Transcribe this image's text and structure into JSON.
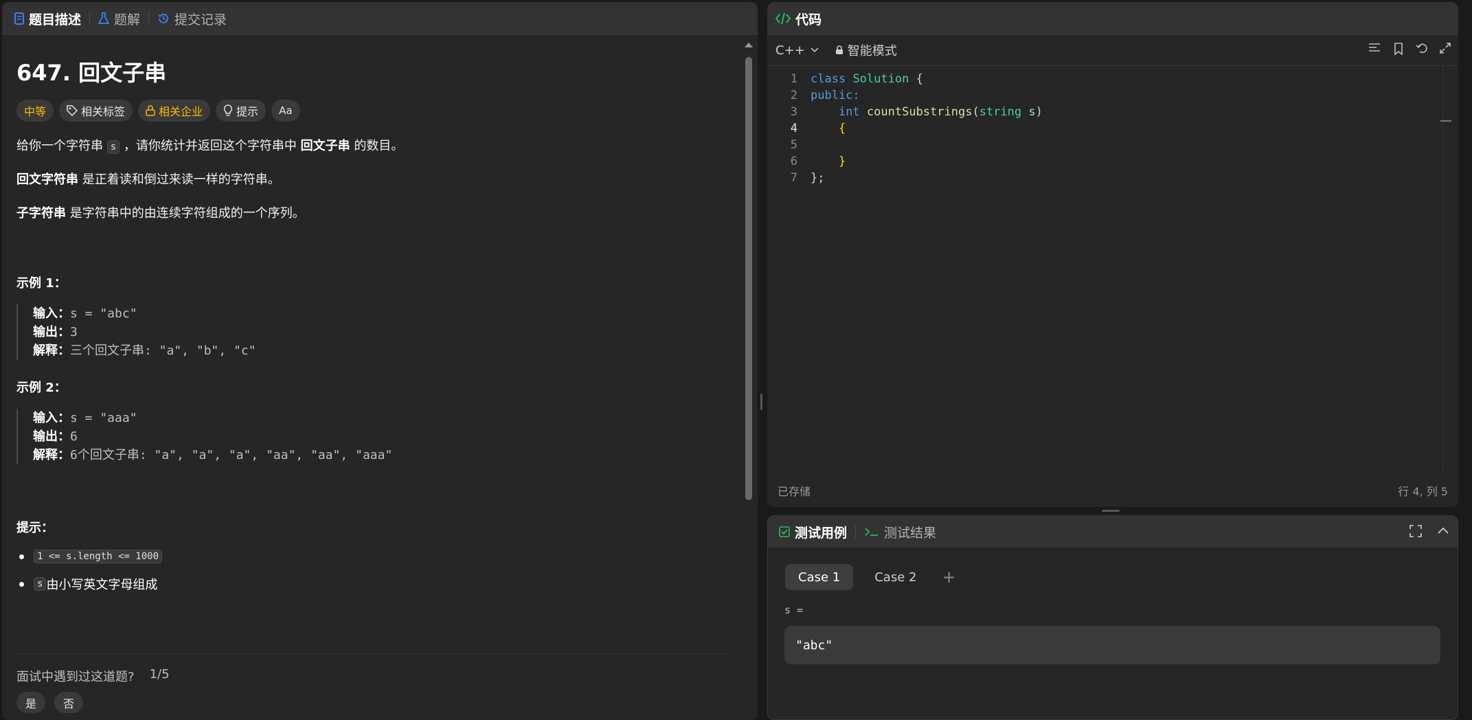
{
  "left_tabs": [
    {
      "label": "题目描述",
      "icon": "document-icon"
    },
    {
      "label": "题解",
      "icon": "flask-icon"
    },
    {
      "label": "提交记录",
      "icon": "history-icon"
    }
  ],
  "problem": {
    "title": "647. 回文子串",
    "tags": {
      "difficulty": "中等",
      "related_tags": "相关标签",
      "related_companies": "相关企业",
      "hint": "提示",
      "font_size_icon": "Aa"
    },
    "desc": {
      "p1_pre": "给你一个字符串 ",
      "p1_code": "s",
      "p1_mid": " ，请你统计并返回这个字符串中 ",
      "p1_bold": "回文子串",
      "p1_post": " 的数目。",
      "p2_bold": "回文字符串",
      "p2_post": " 是正着读和倒过来读一样的字符串。",
      "p3_bold": "子字符串",
      "p3_post": " 是字符串中的由连续字符组成的一个序列。"
    },
    "examples": [
      {
        "title": "示例 1：",
        "input_label": "输入：",
        "input": "s = \"abc\"",
        "output_label": "输出：",
        "output": "3",
        "explain_label": "解释：",
        "explain": "三个回文子串: \"a\", \"b\", \"c\""
      },
      {
        "title": "示例 2：",
        "input_label": "输入：",
        "input": "s = \"aaa\"",
        "output_label": "输出：",
        "output": "6",
        "explain_label": "解释：",
        "explain": "6个回文子串: \"a\", \"a\", \"a\", \"aa\", \"aa\", \"aaa\""
      }
    ],
    "hints_title": "提示：",
    "constraints": [
      {
        "code": "1 <= s.length <= 1000",
        "text": ""
      },
      {
        "code": "s",
        "text": " 由小写英文字母组成"
      }
    ],
    "interview": {
      "question": "面试中遇到过这道题?",
      "count": "1/5",
      "yes": "是",
      "no": "否"
    }
  },
  "code_panel": {
    "title": "代码",
    "language": "C++",
    "mode": "智能模式",
    "saved": "已存储",
    "cursor_pos": "行 4, 列 5",
    "line_numbers": [
      "1",
      "2",
      "3",
      "4",
      "5",
      "6",
      "7"
    ],
    "code": {
      "l1_kw": "class",
      "l1_ty": "Solution",
      "l1_rest": " {",
      "l2": "public:",
      "l3_kw": "int",
      "l3_fn": "countSubstrings",
      "l3_paren": "(",
      "l3_ty": "string",
      "l3_arg": " s",
      "l3_close": ")",
      "l4": "{",
      "l6": "}",
      "l7": "};"
    }
  },
  "test_panel": {
    "tab_cases": "测试用例",
    "tab_results": "测试结果",
    "cases": [
      "Case 1",
      "Case 2"
    ],
    "add": "+",
    "var_label": "s =",
    "var_value": "\"abc\""
  },
  "colors": {
    "accent_green": "#2cbb5d",
    "difficulty": "#ffb800",
    "keyword": "#569cd6",
    "type": "#4ec9b0",
    "function": "#dcdcaa"
  }
}
